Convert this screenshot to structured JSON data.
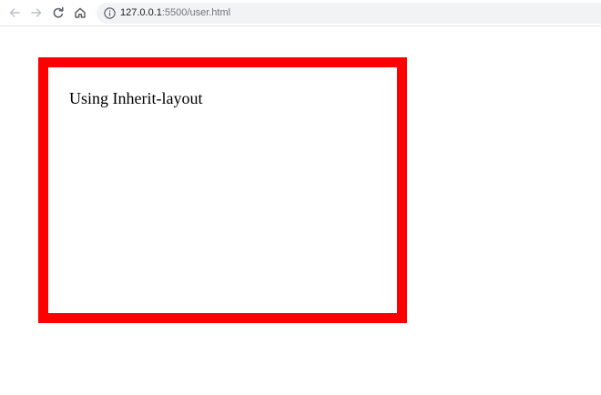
{
  "browser": {
    "url": {
      "host": "127.0.0.1",
      "rest": ":5500/user.html"
    },
    "icons": {
      "back": "arrow-left-icon",
      "forward": "arrow-right-icon",
      "reload": "reload-icon",
      "home": "home-icon",
      "site_info": "info-circle-icon"
    },
    "colors": {
      "omnibox_bg": "#f1f3f4",
      "icon": "#5f6368",
      "icon_disabled": "#bdc1c6"
    }
  },
  "page": {
    "text": "Using Inherit-layout",
    "border_color": "#ff0000"
  }
}
